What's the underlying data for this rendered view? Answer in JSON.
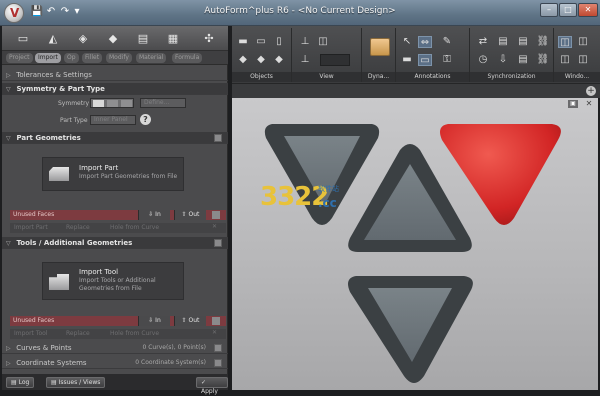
{
  "window": {
    "title": "AutoForm^plus R6 - <No Current Design>",
    "controls": {
      "minimize": "–",
      "restore": "□",
      "close": "✕"
    }
  },
  "quick_access": [
    "💾",
    "↶",
    "↷",
    "▾"
  ],
  "left_panel": {
    "workflow_tabs": [
      "Project",
      "Import",
      "Op",
      "Fillet",
      "Modify",
      "Material",
      "Formula"
    ],
    "active_tab": "Import",
    "sections": {
      "tolerances": "Tolerances & Settings",
      "symmetry": "Symmetry & Part Type",
      "symmetry_label": "Symmetry",
      "symmetry_define": "Define...",
      "part_type_label": "Part Type",
      "part_type_value": "Inner Panel",
      "part_geometries": "Part Geometries",
      "import_part_title": "Import Part",
      "import_part_sub": "Import Part Geometries from File",
      "unused_faces": "Unused Faces",
      "in_label": "In",
      "out_label": "Out",
      "part_row": [
        "Import Part",
        "Replace",
        "Hole from Curve"
      ],
      "tools": "Tools / Additional Geometries",
      "import_tool_title": "Import Tool",
      "import_tool_sub_1": "Import Tools or Additional",
      "import_tool_sub_2": "Geometries from File",
      "unused_faces_2": "Unused Faces",
      "tool_row": [
        "Import Tool",
        "Replace",
        "Hole from Curve"
      ],
      "curves": "Curves & Points",
      "curves_count": "0 Curve(s), 0 Point(s)",
      "coord": "Coordinate Systems",
      "coord_count": "0 Coordinate System(s)"
    },
    "bottom": {
      "log": "Log",
      "issues": "Issues / Views",
      "apply": "Apply"
    }
  },
  "ribbon": {
    "groups": [
      "Objects",
      "View",
      "Dyna...",
      "Annotations",
      "Synchronization",
      "Windo..."
    ]
  },
  "watermark": {
    "digits": "3322",
    "cn": "软件站",
    "cc": ".cc"
  },
  "colors": {
    "accent_red": "#d62a2a",
    "dark_triangle": "#3d4245",
    "triangle_fill": "#6d767c",
    "unused_faces": "#7d3b40"
  }
}
